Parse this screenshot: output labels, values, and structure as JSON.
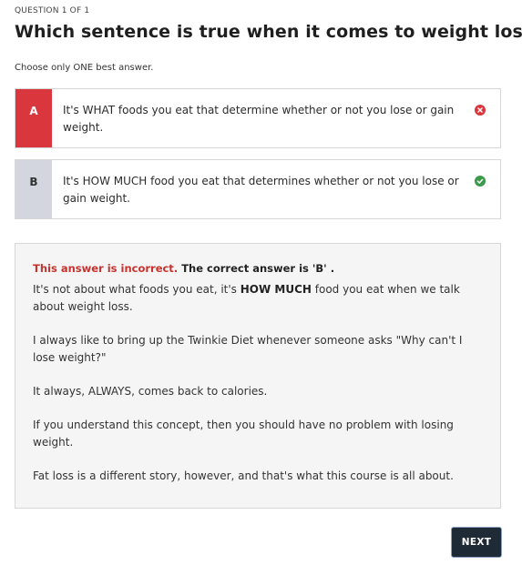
{
  "question": {
    "counter": "QUESTION 1 OF 1",
    "title": "Which sentence is true when it comes to weight loss?",
    "instructions": "Choose only ONE best answer."
  },
  "options": [
    {
      "letter": "A",
      "text": "It's WHAT foods you eat that determine whether or not you lose or gain weight.",
      "status_icon": "x-circle-icon",
      "status_color": "#d9363e"
    },
    {
      "letter": "B",
      "text": "It's HOW MUCH food you eat that determines whether or not you lose or gain weight.",
      "status_icon": "check-circle-icon",
      "status_color": "#3a9a4a"
    }
  ],
  "feedback": {
    "incorrect_label": "This answer is incorrect.",
    "correct_label": "The correct answer is 'B' .",
    "p1_before": "It's not about what foods you eat, it's ",
    "p1_bold": "HOW MUCH",
    "p1_after": " food you eat when we talk about weight loss.",
    "p2": "I always like to bring up the Twinkie Diet whenever someone asks \"Why can't I lose weight?\"",
    "p3": "It always, ALWAYS, comes back to calories.",
    "p4": "If you understand this concept, then you should have no problem with losing weight.",
    "p5": "Fat loss is a different story, however, and that's what this course is all about."
  },
  "next_button": {
    "label": "NEXT"
  },
  "colors": {
    "incorrect": "#d9363e",
    "correct": "#3a9a4a",
    "button_bg": "#1f2a37"
  }
}
